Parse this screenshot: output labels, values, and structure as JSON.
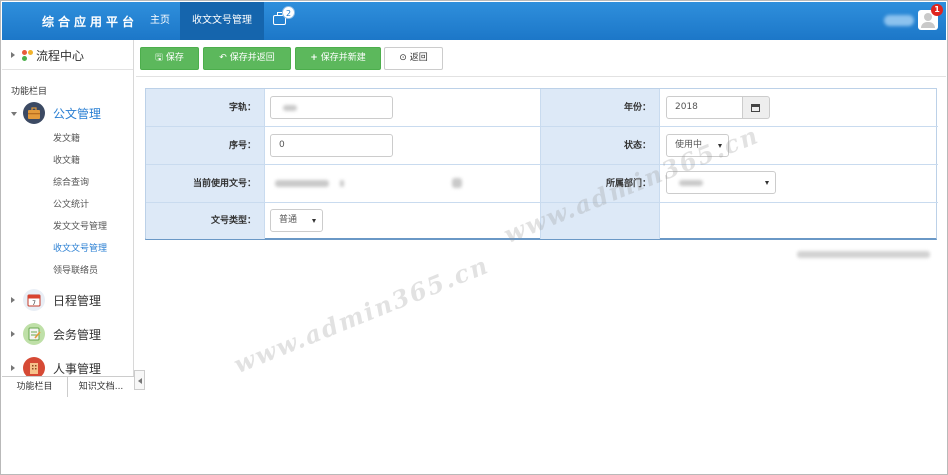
{
  "header": {
    "brand": "综合应用平台",
    "nav": [
      {
        "label": "主页"
      },
      {
        "label": "收文文号管理"
      }
    ],
    "plugin_badge": "2",
    "avatar_badge": "1"
  },
  "sidebar": {
    "top_item": "流程中心",
    "section_label": "功能栏目",
    "menus": [
      {
        "label": "公文管理",
        "expanded": true,
        "icon": "briefcase-icon"
      },
      {
        "label": "日程管理",
        "icon": "calendar-icon"
      },
      {
        "label": "会务管理",
        "icon": "notebook-icon"
      },
      {
        "label": "人事管理",
        "icon": "building-icon"
      }
    ],
    "sub_items": [
      "发文籍",
      "收文籍",
      "综合查询",
      "公文统计",
      "发文文号管理",
      "收文文号管理",
      "领导联络员"
    ],
    "active_sub": "收文文号管理",
    "bottom_tabs": [
      "功能栏目",
      "知识文档..."
    ]
  },
  "toolbar": {
    "save": "保存",
    "save_return": "保存并返回",
    "save_new": "保存并新建",
    "back": "返回"
  },
  "form": {
    "labels": {
      "word": "字轨：",
      "year": "年份：",
      "seq": "序号：",
      "status": "状态：",
      "current": "当前使用文号：",
      "dept": "所属部门：",
      "type": "文号类型："
    },
    "year_value": "2018",
    "seq_value": "0",
    "status_value": "使用中",
    "type_value": "普通"
  },
  "watermark": "www.admin365.cn",
  "colors": {
    "topbar": "#1c77c8",
    "nav_active": "#1565ad",
    "button_green": "#5cb85c",
    "label_bg": "#dde9f7",
    "active_link": "#2a7fd3"
  }
}
